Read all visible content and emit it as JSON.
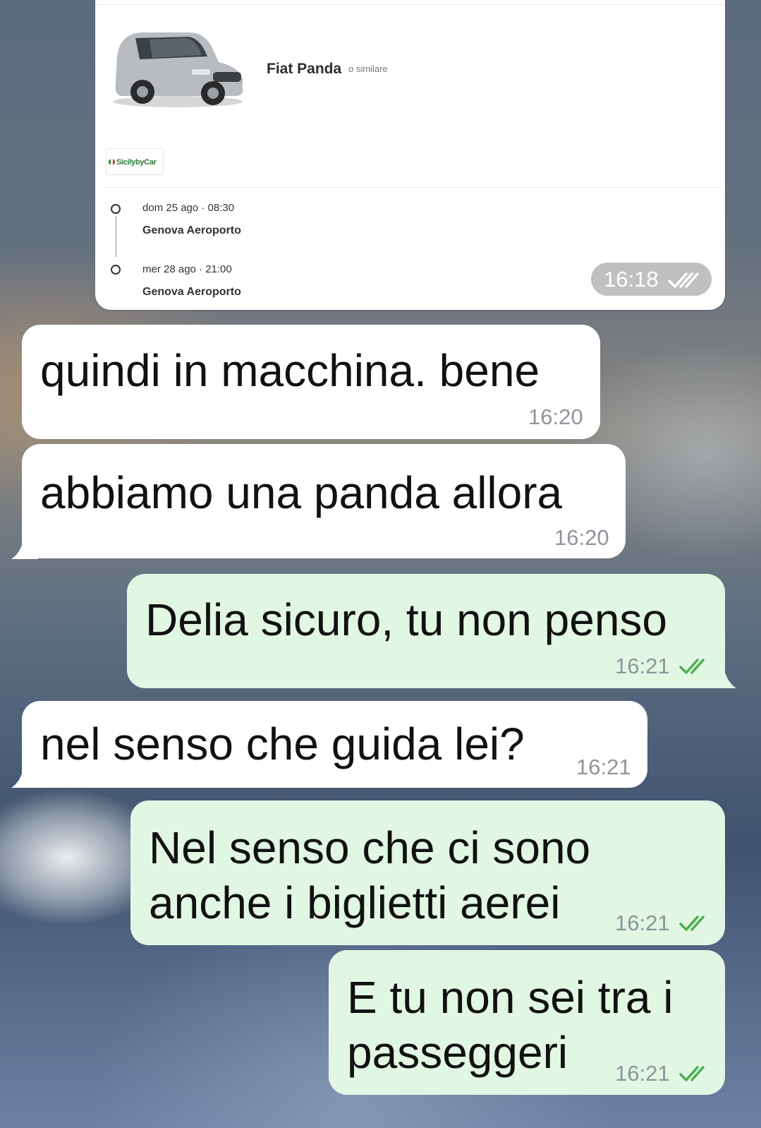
{
  "card": {
    "car_name": "Fiat Panda",
    "car_sub": "o similare",
    "brand": "SicilybyCar",
    "pickup_date": "dom 25 ago · 08:30",
    "pickup_place": "Genova Aeroporto",
    "return_date": "mer 28 ago · 21:00",
    "return_place": "Genova Aeroporto",
    "time": "16:18"
  },
  "messages": [
    {
      "side": "in",
      "text": "quindi in macchina. bene",
      "time": "16:20"
    },
    {
      "side": "in",
      "text": "abbiamo una panda allora",
      "time": "16:20"
    },
    {
      "side": "out",
      "text": "Delia sicuro, tu non penso",
      "time": "16:21"
    },
    {
      "side": "in",
      "text": "nel senso che guida lei?",
      "time": "16:21"
    },
    {
      "side": "out",
      "text_line1": "Nel senso che ci sono",
      "text_line2": "anche i biglietti aerei",
      "time": "16:21"
    },
    {
      "side": "out",
      "text_line1": "E tu non sei tra i",
      "text_line2": "passeggeri",
      "time": "16:21"
    }
  ],
  "colors": {
    "incoming_bubble": "#ffffff",
    "outgoing_bubble": "#e2f6e4",
    "read_ticks": "#4caf50",
    "timestamp": "#8f959b"
  }
}
